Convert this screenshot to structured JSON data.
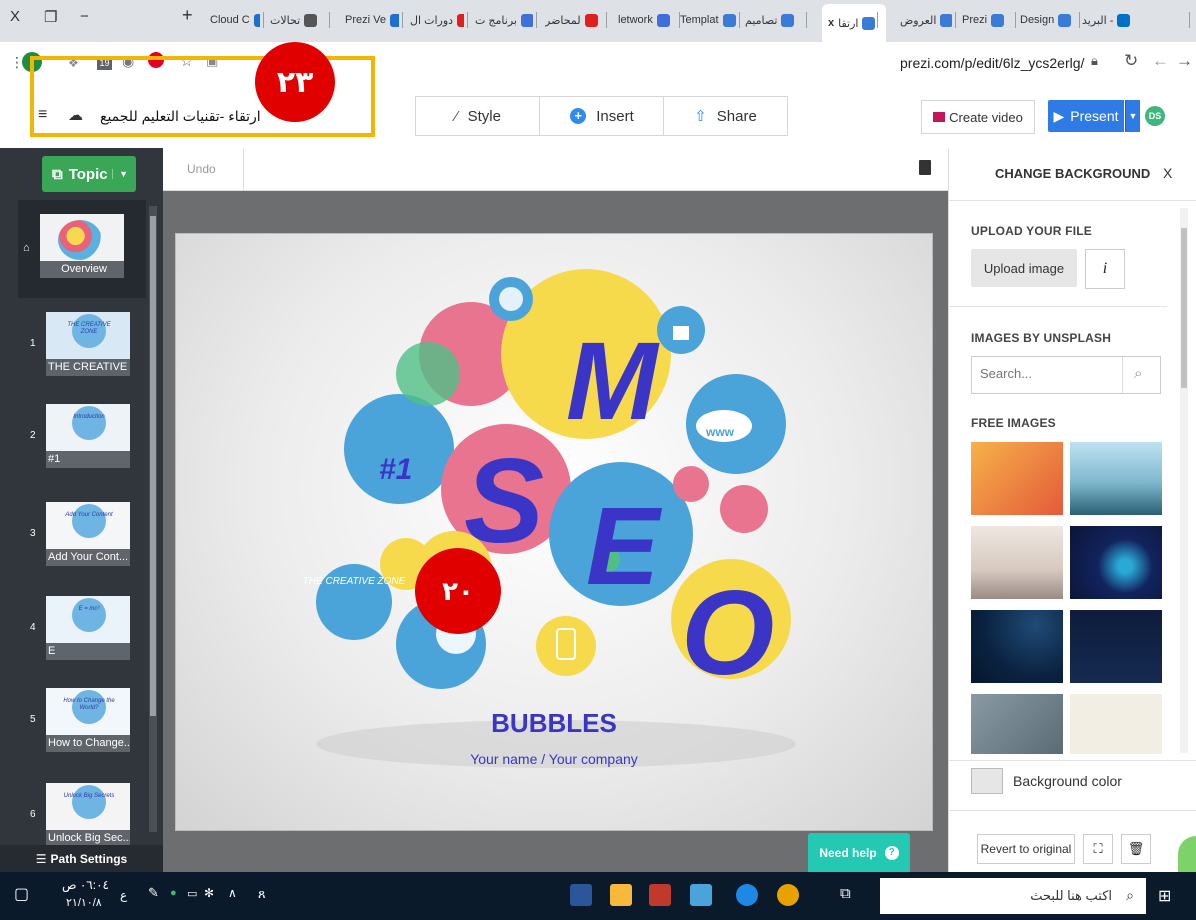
{
  "browser": {
    "window_controls": {
      "close": "X",
      "restore": "❐",
      "minimize": "−"
    },
    "new_tab": "+",
    "tabs": [
      {
        "label": "Cloud C",
        "color": "#1f6fd1"
      },
      {
        "label": "تحالات",
        "color": "#555555"
      },
      {
        "label": "Prezi Ve",
        "color": "#1f6fd1"
      },
      {
        "label": "دورات ال",
        "color": "#e0201e"
      },
      {
        "label": "برنامج ت",
        "color": "#3f6fd8"
      },
      {
        "label": "لمحاضر",
        "color": "#e0201e"
      },
      {
        "label": "letwork",
        "color": "#3f6fd8"
      },
      {
        "label": "Templat",
        "color": "#3a7bd5"
      },
      {
        "label": "تصاميم",
        "color": "#3a7bd5"
      },
      {
        "label": "ارتقا",
        "color": "#3a7bd5"
      },
      {
        "label": "العروض",
        "color": "#3a7bd5"
      },
      {
        "label": "Prezi",
        "color": "#3a7bd5"
      },
      {
        "label": "Design",
        "color": "#3a7bd5"
      },
      {
        "label": "البريد -",
        "color": "#0072c6"
      }
    ],
    "tab_close": "x",
    "url": "prezi.com/p/edit/6lz_ycs2erlg/",
    "ext_badge": "19",
    "annotation_top": "٢٣",
    "annotation_slide": "٢٠"
  },
  "toolbar": {
    "presentation_title": "ارتقاء -تقنيات التعليم للجميع",
    "style_label": "Style",
    "insert_label": "Insert",
    "share_label": "Share",
    "create_video_label": "Create video",
    "present_label": "Present",
    "avatar_initials": "DS"
  },
  "left_panel": {
    "topic_label": "Topic",
    "overview_label": "Overview",
    "thumbnails": [
      {
        "num": "1",
        "caption": "THE CREATIVE ...",
        "inner": "THE CREATIVE ZONE"
      },
      {
        "num": "2",
        "caption": "#1",
        "inner": "Introduction"
      },
      {
        "num": "3",
        "caption": "Add Your Cont...",
        "inner": "Add Your Content"
      },
      {
        "num": "4",
        "caption": "E",
        "inner": "E = mc²"
      },
      {
        "num": "5",
        "caption": "How to Change...",
        "inner": "How to Change the World?"
      },
      {
        "num": "6",
        "caption": "Unlock Big Sec...",
        "inner": "Unlock Big Secrets"
      }
    ],
    "path_settings_label": "Path Settings"
  },
  "canvas": {
    "undo_label": "Undo",
    "slide": {
      "letter_m": "M",
      "letter_s": "S",
      "letter_e": "E",
      "letter_o": "O",
      "hash_one": "#1",
      "www": "www",
      "creative_zone": "THE CREATIVE ZONE",
      "title": "BUBBLES",
      "subtitle": "Your name / Your company"
    },
    "need_help_label": "Need help",
    "need_help_icon": "?"
  },
  "right_panel": {
    "header": "CHANGE BACKGROUND",
    "close": "X",
    "upload_heading": "UPLOAD YOUR FILE",
    "upload_button": "Upload image",
    "info_glyph": "i",
    "unsplash_heading": "IMAGES BY UNSPLASH",
    "search_placeholder": "Search...",
    "free_heading": "FREE IMAGES",
    "bg_color_label": "Background color",
    "revert_label": "Revert to original"
  },
  "taskbar": {
    "search_placeholder": "اكتب هنا للبحث",
    "time": "٠٦:٠٤ ص",
    "date": "٢١/١٠/٨",
    "lang": "ع"
  }
}
